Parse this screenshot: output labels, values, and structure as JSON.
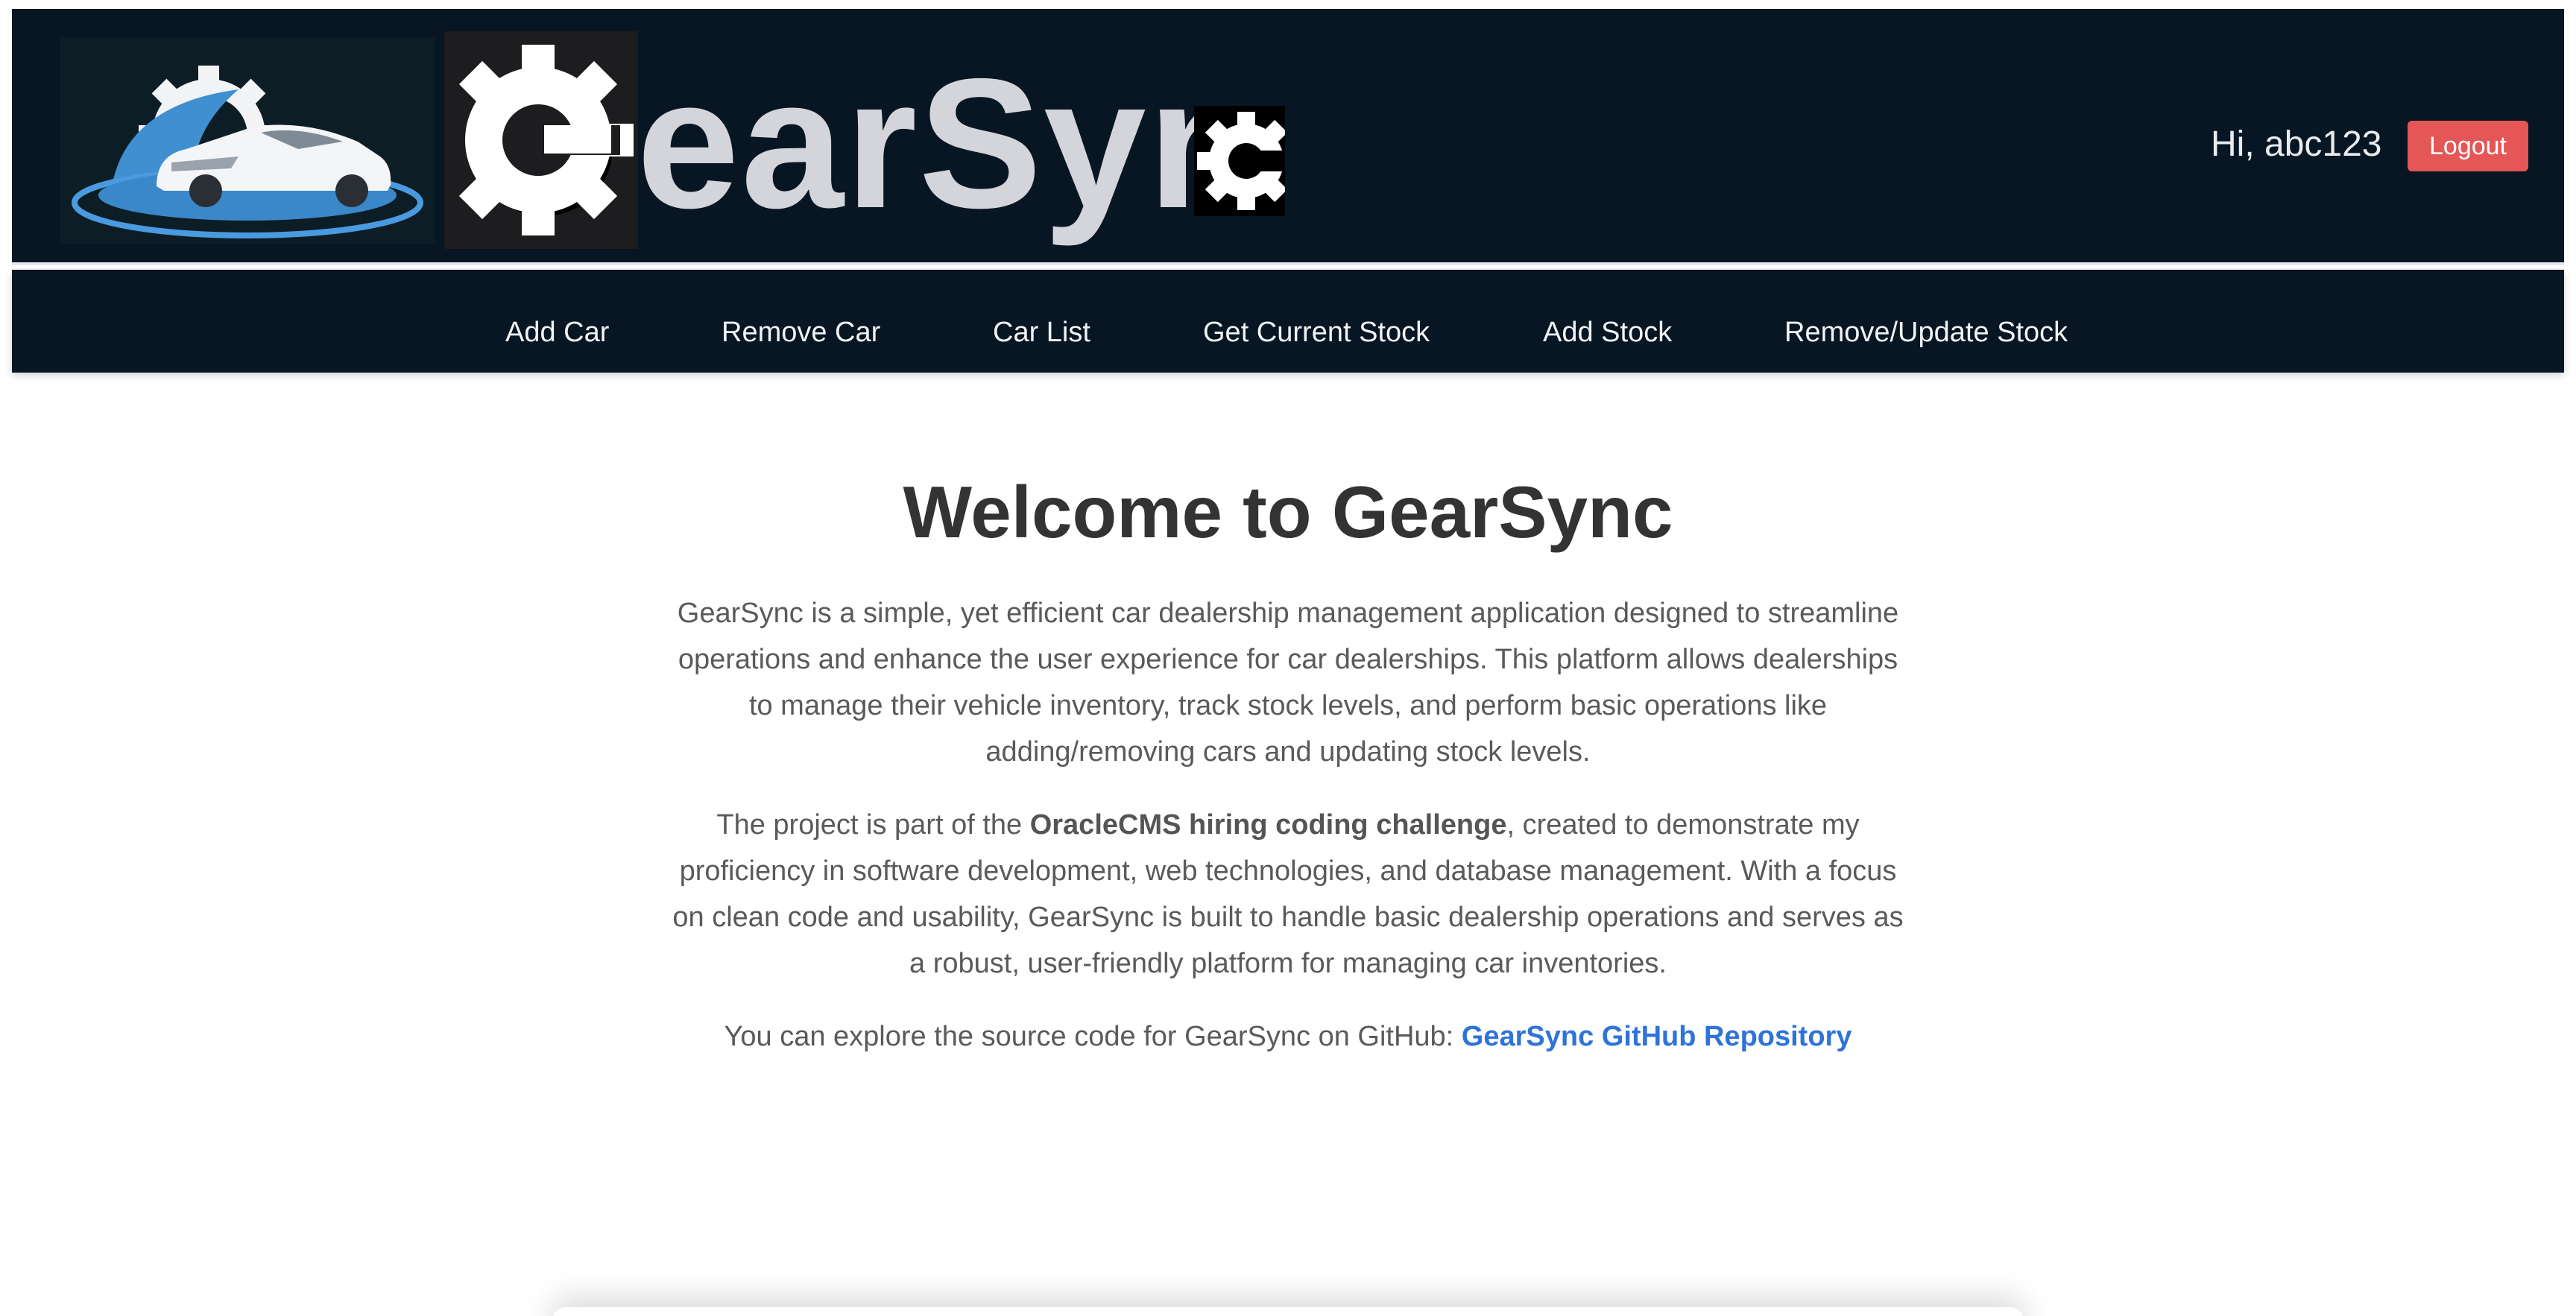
{
  "header": {
    "brand_name": "GearSync",
    "brand_text": "earSyn",
    "greeting": "Hi, abc123",
    "logout_label": "Logout"
  },
  "nav": {
    "items": [
      {
        "label": "Add Car"
      },
      {
        "label": "Remove Car"
      },
      {
        "label": "Car List"
      },
      {
        "label": "Get Current Stock"
      },
      {
        "label": "Add Stock"
      },
      {
        "label": "Remove/Update Stock"
      }
    ]
  },
  "main": {
    "title": "Welcome to GearSync",
    "intro": "GearSync is a simple, yet efficient car dealership management application designed to streamline operations and enhance the user experience for car dealerships. This platform allows dealerships to manage their vehicle inventory, track stock levels, and perform basic operations like adding/removing cars and updating stock levels.",
    "project_prefix": "The project is part of the ",
    "project_highlight": "OracleCMS hiring coding challenge",
    "project_suffix": ", created to demonstrate my proficiency in software development, web technologies, and database management. With a focus on clean code and usability, GearSync is built to handle basic dealership operations and serves as a robust, user-friendly platform for managing car inventories.",
    "github_prefix": "You can explore the source code for GearSync on GitHub: ",
    "github_link": "GearSync GitHub Repository"
  },
  "colors": {
    "header_bg": "#081522",
    "logout_bg": "#e55656",
    "link": "#2f73d8",
    "title": "#333333",
    "body_text": "#5a5a5a"
  },
  "icons": [
    "car-logo-icon",
    "gear-icon",
    "gear-small-icon"
  ]
}
